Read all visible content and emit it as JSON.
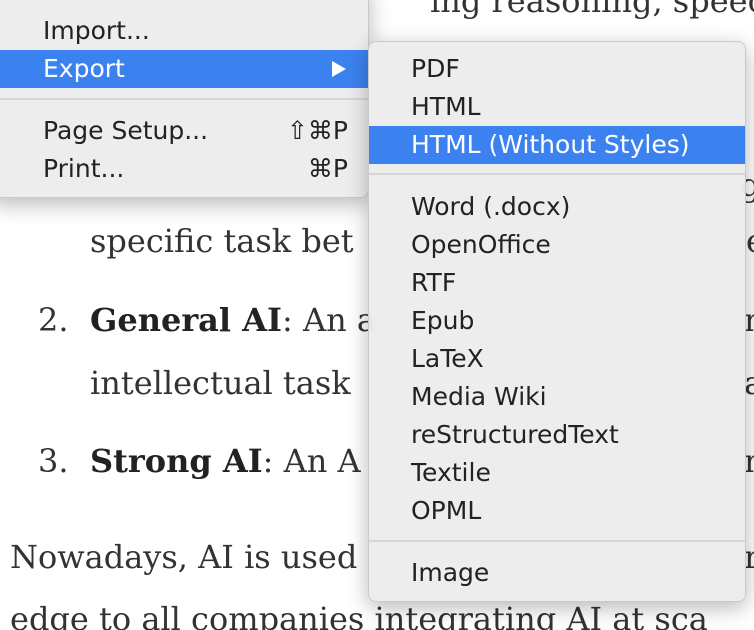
{
  "document": {
    "line_partial_top": "ing reasoning, speec",
    "line_right_fragment_1": "g",
    "line_specific": "specific task bet",
    "line_specific_right": "e",
    "item2_number": "2.",
    "item2_bold": "General AI",
    "item2_text": ": An a",
    "item2_right": "n",
    "line_intellectual": "intellectual task",
    "line_intellectual_right": "a",
    "item3_number": "3.",
    "item3_bold": "Strong AI",
    "item3_text": ": An A",
    "item3_right": "n",
    "line_nowadays": "Nowadays, AI is used",
    "line_nowadays_right": "r",
    "line_bottom": "edge to all companies integrating AI at sca"
  },
  "file_menu": {
    "items": [
      {
        "label": "Import...",
        "shortcut": ""
      },
      {
        "label": "Export",
        "shortcut": "",
        "has_submenu": true
      },
      {
        "label": "Page Setup...",
        "shortcut": "⇧⌘P"
      },
      {
        "label": "Print...",
        "shortcut": "⌘P"
      }
    ],
    "selected": "Export"
  },
  "export_submenu": {
    "items": [
      {
        "label": "PDF"
      },
      {
        "label": "HTML"
      },
      {
        "label": "HTML (Without Styles)"
      },
      {
        "label": "Word (.docx)"
      },
      {
        "label": "OpenOffice"
      },
      {
        "label": "RTF"
      },
      {
        "label": "Epub"
      },
      {
        "label": "LaTeX"
      },
      {
        "label": "Media Wiki"
      },
      {
        "label": "reStructuredText"
      },
      {
        "label": "Textile"
      },
      {
        "label": "OPML"
      },
      {
        "label": "Image"
      }
    ],
    "selected": "HTML (Without Styles)"
  },
  "colors": {
    "menu_background": "#ececec",
    "selection": "#3b82f0",
    "document_text": "#333333"
  },
  "icons": {
    "submenu_arrow": "triangle-right-icon"
  }
}
